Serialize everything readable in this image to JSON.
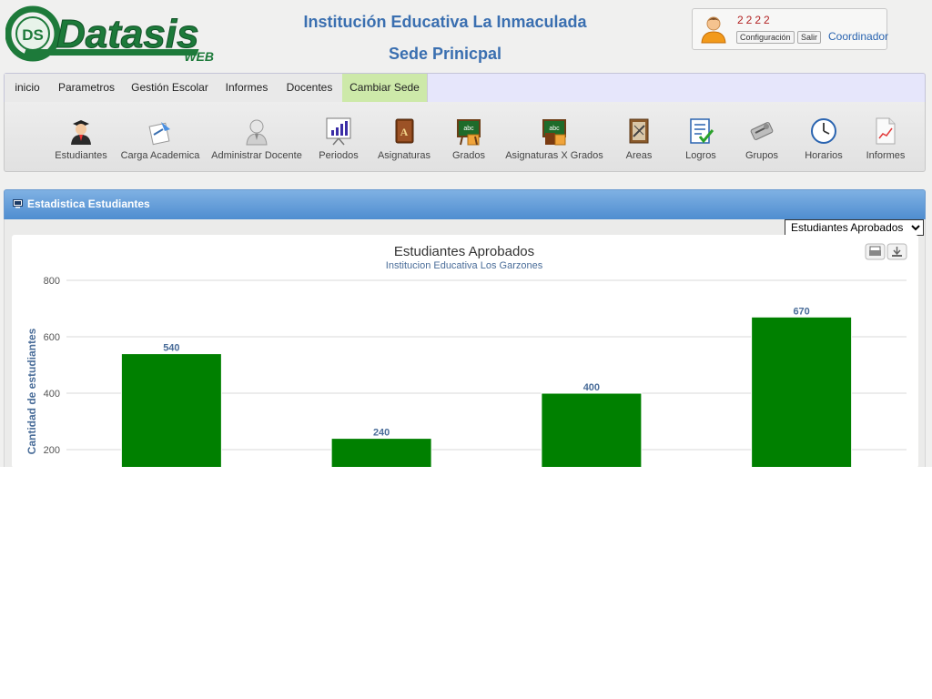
{
  "header": {
    "logo_text": "Datasis",
    "logo_sub": "WEB",
    "institution": "Institución Educativa La Inmaculada",
    "sede": "Sede Prinicpal"
  },
  "user": {
    "name": "2222",
    "config_label": "Configuración",
    "logout_label": "Salir",
    "role": "Coordinador"
  },
  "nav": {
    "tabs": [
      {
        "label": "inicio"
      },
      {
        "label": "Parametros"
      },
      {
        "label": "Gestión Escolar"
      },
      {
        "label": "Informes"
      },
      {
        "label": "Docentes"
      },
      {
        "label": "Cambiar Sede"
      }
    ],
    "active": "Cambiar Sede"
  },
  "toolbar": {
    "items": [
      {
        "label": "Estudiantes",
        "icon": "student-icon"
      },
      {
        "label": "Carga Academica",
        "icon": "academic-load-icon"
      },
      {
        "label": "Administrar Docente",
        "icon": "teacher-admin-icon"
      },
      {
        "label": "Periodos",
        "icon": "periods-chart-icon"
      },
      {
        "label": "Asignaturas",
        "icon": "subjects-book-icon"
      },
      {
        "label": "Grados",
        "icon": "grades-board-icon"
      },
      {
        "label": "Asignaturas X Grados",
        "icon": "subjects-grades-icon"
      },
      {
        "label": "Areas",
        "icon": "areas-icon"
      },
      {
        "label": "Logros",
        "icon": "achievements-checklist-icon"
      },
      {
        "label": "Grupos",
        "icon": "groups-icon"
      },
      {
        "label": "Horarios",
        "icon": "clock-icon"
      },
      {
        "label": "Informes",
        "icon": "reports-icon"
      }
    ]
  },
  "panel": {
    "title": "Estadistica Estudiantes",
    "select_value": "Estudiantes Aprobados"
  },
  "colors": {
    "bar": "#008000",
    "accent": "#3a6fb0",
    "active_tab": "#cde9a9"
  },
  "chart_data": {
    "type": "bar",
    "title": "Estudiantes Aprobados",
    "subtitle": "Institucion Educativa Los Garzones",
    "ylabel": "Cantidad de estudiantes",
    "xlabel": "",
    "ylim": [
      0,
      800
    ],
    "yticks": [
      200,
      400,
      600,
      800
    ],
    "grid": true,
    "categories": [
      "",
      "",
      "",
      ""
    ],
    "values": [
      540,
      240,
      400,
      670
    ]
  }
}
